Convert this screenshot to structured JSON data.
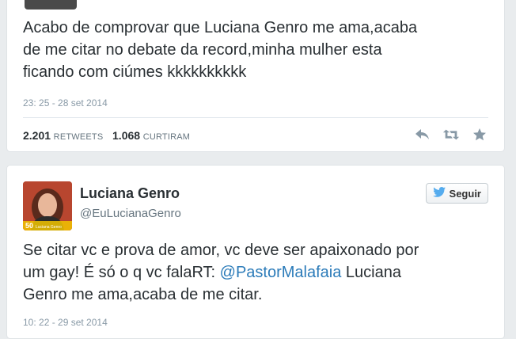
{
  "tweet1": {
    "text": "Acabo de comprovar que Luciana Genro me ama,acaba\nde me citar no debate da record,minha mulher esta\nficando com ciúmes  kkkkkkkkkk",
    "timestamp": "23: 25 - 28 set 2014",
    "retweets_count": "2.201",
    "retweets_label": "RETWEETS",
    "likes_count": "1.068",
    "likes_label": "CURTIRAM",
    "icons": [
      "reply-icon",
      "retweet-icon",
      "favorite-icon"
    ]
  },
  "tweet2": {
    "display_name": "Luciana Genro",
    "handle": "@EuLucianaGenro",
    "follow_label": "Seguir",
    "text_before": "Se citar vc e prova de amor, vc deve ser apaixonado por\num gay! É só o q vc falaRT: ",
    "mention": "@PastorMalafaia",
    "text_after": " Luciana\nGenro me ama,acaba de me citar.",
    "timestamp": "10: 22 - 29 set 2014",
    "avatar_badge": "50",
    "avatar_caption": "Luciana Genro"
  },
  "colors": {
    "link": "#2b7bb9",
    "text": "#292f33",
    "muted": "#8899a6",
    "twitter_bird": "#55acee"
  }
}
